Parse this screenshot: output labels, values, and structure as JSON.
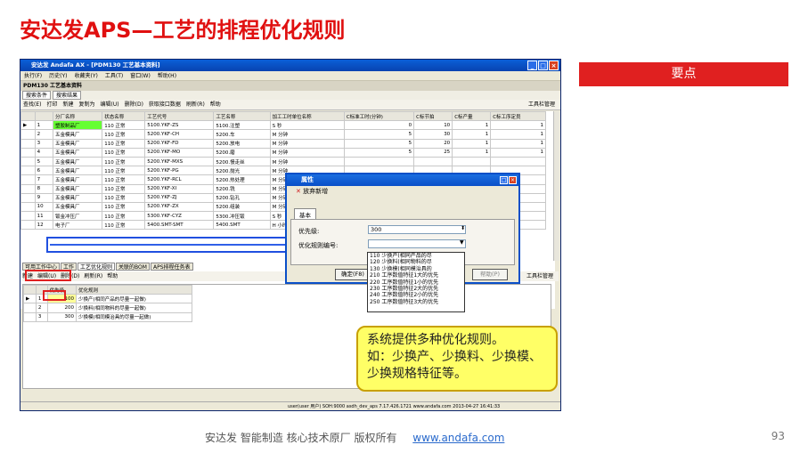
{
  "slide": {
    "title": "安达发APS—工艺的排程优化规则",
    "keypoint_label": "要点",
    "footer_text": "安达发   智能制造 核心技术原厂   版权所有",
    "footer_link": "www.andafa.com",
    "page_number": "93"
  },
  "window": {
    "title": "安达发 Andafa AX - [PDM130 工艺基本资料]",
    "menu": [
      "执行(F)",
      "历史(Y)",
      "收藏夹(Y)",
      "工具(T)",
      "窗口(W)",
      "帮助(H)"
    ],
    "doc_tab": "PDM130 工艺基本资料",
    "sub_tabs": [
      "搜索条件",
      "搜索结果"
    ],
    "toolbar": [
      "查找(E)",
      "打印",
      "新建",
      "复制为",
      "编辑(U)",
      "删除(D)",
      "获取接口数据",
      "刷新(R)",
      "帮助"
    ],
    "toolbar_right": "工具栏管理",
    "columns": [
      "",
      "",
      "分厂名称",
      "状态名称",
      "工艺代号",
      "工艺名称",
      "加工工时单位名称",
      "C标准工时(分钟)",
      "C标节拍",
      "C标产量",
      "C标工序定员"
    ],
    "rows": [
      [
        "▶",
        "1",
        "塑胶制品厂",
        "110 正常",
        "5100.YKF-ZS",
        "5100.注塑",
        "S 秒",
        "0",
        "10",
        "1",
        "1"
      ],
      [
        "",
        "2",
        "五金模具厂",
        "110 正常",
        "5200.YKF-CH",
        "5200.车",
        "M 分钟",
        "5",
        "30",
        "1",
        "1"
      ],
      [
        "",
        "3",
        "五金模具厂",
        "110 正常",
        "5200.YKF-FD",
        "5200.放电",
        "M 分钟",
        "5",
        "20",
        "1",
        "1"
      ],
      [
        "",
        "4",
        "五金模具厂",
        "110 正常",
        "5200.YKF-MO",
        "5200.磨",
        "M 分钟",
        "5",
        "25",
        "1",
        "1"
      ],
      [
        "",
        "5",
        "五金模具厂",
        "110 正常",
        "5200.YKF-MXS",
        "5200.慢走丝",
        "M 分钟",
        "",
        "",
        "",
        ""
      ],
      [
        "",
        "6",
        "五金模具厂",
        "110 正常",
        "5200.YKF-PG",
        "5200.抛光",
        "M 分钟",
        "",
        "",
        "",
        ""
      ],
      [
        "",
        "7",
        "五金模具厂",
        "110 正常",
        "5200.YKF-RCL",
        "5200.热处理",
        "M 分钟",
        "",
        "",
        "",
        ""
      ],
      [
        "",
        "8",
        "五金模具厂",
        "110 正常",
        "5200.YKF-XI",
        "5200.铣",
        "M 分钟",
        "",
        "",
        "",
        ""
      ],
      [
        "",
        "9",
        "五金模具厂",
        "110 正常",
        "5200.YKF-ZJ",
        "5200.钻孔",
        "M 分钟",
        "",
        "",
        "",
        ""
      ],
      [
        "",
        "10",
        "五金模具厂",
        "110 正常",
        "5200.YKF-ZX",
        "5200.组装",
        "M 分钟",
        "",
        "",
        "",
        ""
      ],
      [
        "",
        "11",
        "钣金冲压厂",
        "110 正常",
        "5300.YKF-CYZ",
        "5300.冲压钣",
        "S 秒",
        "",
        "",
        "",
        ""
      ],
      [
        "",
        "12",
        "电子厂",
        "110 正常",
        "5400.SMT-SMT",
        "5400.SMT",
        "H 小时",
        "",
        "",
        "",
        ""
      ]
    ],
    "lower_tabs": [
      "可用工作中心",
      "工作",
      "工艺优化规则",
      "关联的BOM",
      "APS排程任务表"
    ],
    "lower_toolbar": [
      "新建",
      "编辑(U)",
      "删除(D)",
      "刷新(R)",
      "帮助"
    ],
    "lower_toolbar_right": "工具栏管理",
    "lower_columns": [
      "",
      "",
      "优先级",
      "优化规则"
    ],
    "lower_rows": [
      [
        "▶",
        "1",
        "100",
        "少换产(相同产品的尽量一起做)"
      ],
      [
        "",
        "2",
        "200",
        "少换料(相同物料的尽量一起做)"
      ],
      [
        "",
        "3",
        "300",
        "少换模(相同模治具的尽量一起做)"
      ]
    ],
    "status": "user(user 用户)  SOH:9000  asdh_dev_aps  7.17.426.1721  www.andafa.com  2013-04-27 16:41:33"
  },
  "dialog": {
    "title": "属性",
    "toolbar_item": "放弃新增",
    "tab": "基本",
    "priority_label": "优先级:",
    "priority_value": "300",
    "rule_label": "优化规则编号:",
    "rule_value": "",
    "ok_button": "确定(F8)",
    "help_button": "帮助(P)",
    "options": [
      "110  少换产(相同产品的尽",
      "120  少换料(相同物料的尽",
      "130  少换模(相同模治具的",
      "210  工序数值特征1大的优先",
      "220  工序数值特征1小的优先",
      "230  工序数值特征2大的优先",
      "240  工序数值特征2小的优先",
      "250  工序数值特征3大的优先"
    ]
  },
  "callout": {
    "line1": "系统提供多种优化规则。",
    "line2": "如：少换产、少换料、少换模、少换规格特征等。"
  },
  "colors": {
    "title_red": "#e01010",
    "keypoint_bg": "#e02020",
    "callout_bg": "#ffff66",
    "highlight_green": "#66ff33"
  }
}
